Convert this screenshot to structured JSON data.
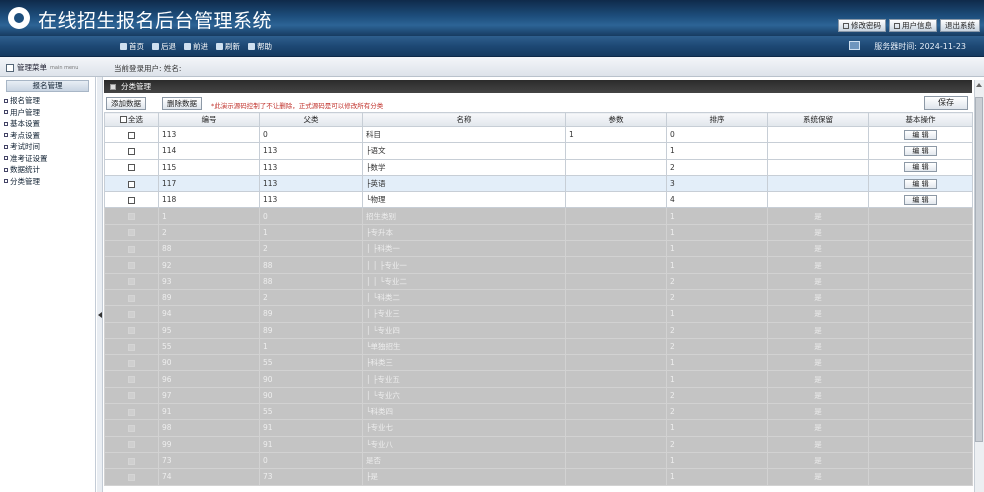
{
  "app": {
    "title": "在线招生报名后台管理系统"
  },
  "header_buttons": [
    {
      "label": "修改密码",
      "icon": "edit-icon"
    },
    {
      "label": "用户信息",
      "icon": "user-icon"
    },
    {
      "label": "退出系统",
      "icon": "exit-icon"
    }
  ],
  "nav": [
    {
      "label": "首页",
      "icon": "home-icon"
    },
    {
      "label": "后退",
      "icon": "back-icon"
    },
    {
      "label": "前进",
      "icon": "forward-icon"
    },
    {
      "label": "刷新",
      "icon": "refresh-icon"
    },
    {
      "label": "帮助",
      "icon": "help-icon"
    }
  ],
  "server_time": "服务器时间: 2024-11-23",
  "info": {
    "menu_label": "管理菜单",
    "menu_sub": "main menu",
    "login_text": "当前登录用户: 姓名:"
  },
  "sidebar": {
    "title": "报名管理",
    "items": [
      "报名管理",
      "用户管理",
      "基本设置",
      "考点设置",
      "考试时间",
      "准考证设置",
      "数据统计",
      "分类管理"
    ]
  },
  "panel": {
    "title": "分类管理"
  },
  "toolbar": {
    "add_label": "添加数据",
    "delete_label": "删除数据",
    "hint": "*此演示源码控制了不让删除，正式源码是可以修改所有分类",
    "save_label": "保存"
  },
  "table": {
    "headers": [
      "全选",
      "编号",
      "父类",
      "名称",
      "参数",
      "排序",
      "系统保留",
      "基本操作"
    ],
    "edit_label": "编 辑",
    "rows": [
      {
        "id": "113",
        "parent": "0",
        "name": "科目",
        "param": "1",
        "order": "0",
        "reserved": "",
        "editable": true
      },
      {
        "id": "114",
        "parent": "113",
        "name": "├语文",
        "param": "",
        "order": "1",
        "reserved": "",
        "editable": true
      },
      {
        "id": "115",
        "parent": "113",
        "name": "├数学",
        "param": "",
        "order": "2",
        "reserved": "",
        "editable": true
      },
      {
        "id": "117",
        "parent": "113",
        "name": "├英语",
        "param": "",
        "order": "3",
        "reserved": "",
        "editable": true
      },
      {
        "id": "118",
        "parent": "113",
        "name": "└物理",
        "param": "",
        "order": "4",
        "reserved": "",
        "editable": true
      },
      {
        "id": "1",
        "parent": "0",
        "name": "招生类别",
        "param": "",
        "order": "1",
        "reserved": "是",
        "editable": false
      },
      {
        "id": "2",
        "parent": "1",
        "name": "├专升本",
        "param": "",
        "order": "1",
        "reserved": "是",
        "editable": false
      },
      {
        "id": "88",
        "parent": "2",
        "name": "│ ├科类一",
        "param": "",
        "order": "1",
        "reserved": "是",
        "editable": false
      },
      {
        "id": "92",
        "parent": "88",
        "name": "│ │ ├专业一",
        "param": "",
        "order": "1",
        "reserved": "是",
        "editable": false
      },
      {
        "id": "93",
        "parent": "88",
        "name": "│ │ └专业二",
        "param": "",
        "order": "2",
        "reserved": "是",
        "editable": false
      },
      {
        "id": "89",
        "parent": "2",
        "name": "│ └科类二",
        "param": "",
        "order": "2",
        "reserved": "是",
        "editable": false
      },
      {
        "id": "94",
        "parent": "89",
        "name": "│   ├专业三",
        "param": "",
        "order": "1",
        "reserved": "是",
        "editable": false
      },
      {
        "id": "95",
        "parent": "89",
        "name": "│   └专业四",
        "param": "",
        "order": "2",
        "reserved": "是",
        "editable": false
      },
      {
        "id": "55",
        "parent": "1",
        "name": "└单独招生",
        "param": "",
        "order": "2",
        "reserved": "是",
        "editable": false
      },
      {
        "id": "90",
        "parent": "55",
        "name": "  ├科类三",
        "param": "",
        "order": "1",
        "reserved": "是",
        "editable": false
      },
      {
        "id": "96",
        "parent": "90",
        "name": "  │ ├专业五",
        "param": "",
        "order": "1",
        "reserved": "是",
        "editable": false
      },
      {
        "id": "97",
        "parent": "90",
        "name": "  │ └专业六",
        "param": "",
        "order": "2",
        "reserved": "是",
        "editable": false
      },
      {
        "id": "91",
        "parent": "55",
        "name": "  └科类四",
        "param": "",
        "order": "2",
        "reserved": "是",
        "editable": false
      },
      {
        "id": "98",
        "parent": "91",
        "name": "    ├专业七",
        "param": "",
        "order": "1",
        "reserved": "是",
        "editable": false
      },
      {
        "id": "99",
        "parent": "91",
        "name": "    └专业八",
        "param": "",
        "order": "2",
        "reserved": "是",
        "editable": false
      },
      {
        "id": "73",
        "parent": "0",
        "name": "是否",
        "param": "",
        "order": "1",
        "reserved": "是",
        "editable": false
      },
      {
        "id": "74",
        "parent": "73",
        "name": "├是",
        "param": "",
        "order": "1",
        "reserved": "是",
        "editable": false
      }
    ]
  }
}
